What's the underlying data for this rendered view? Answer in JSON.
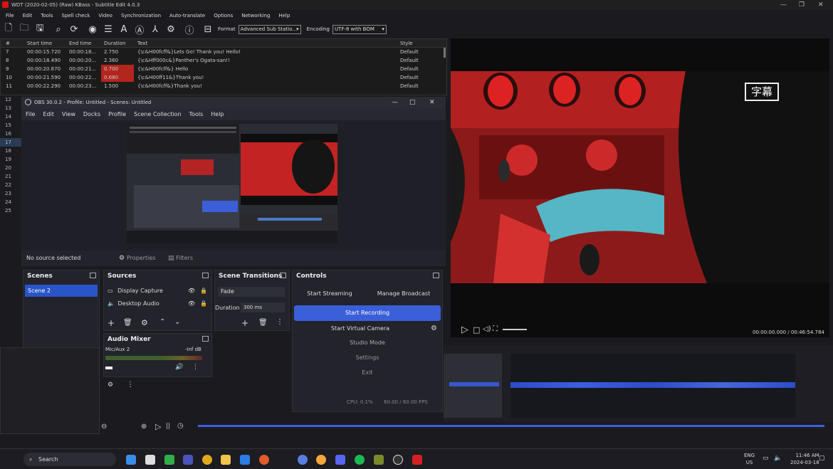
{
  "window": {
    "title": "WDT (2020-02-05) (Raw) KBass - Subtitle Edit 4.0.3"
  },
  "menu": [
    "File",
    "Edit",
    "Tools",
    "Spell check",
    "Video",
    "Synchronization",
    "Auto-translate",
    "Options",
    "Networking",
    "Help"
  ],
  "toolbar": {
    "icons": [
      "new-file-icon",
      "open-folder-icon",
      "save-icon",
      "find-icon",
      "replace-icon",
      "visual-sync-icon",
      "spell-check-icon",
      "fix-errors-icon",
      "translate-icon",
      "remove-text-icon",
      "settings-icon",
      "help-icon",
      "layout-icon"
    ],
    "format_label": "Format",
    "format_value": "Advanced Sub Statio...",
    "encoding_label": "Encoding",
    "encoding_value": "UTF-8 with BOM"
  },
  "grid": {
    "headers": [
      "#",
      "Start time",
      "End time",
      "Duration",
      "Text",
      "Style"
    ],
    "rows": [
      [
        "7",
        "00:00:15.720",
        "00:00:18...",
        "2.750",
        "{\\c&H00fcff&}Lets Go! Thank you! Hello!",
        "Default"
      ],
      [
        "8",
        "00:00:18.490",
        "00:00:20...",
        "2.360",
        "{\\c&Hff000c&}Panther's Ogata-san!!",
        "Default"
      ],
      [
        "9",
        "00:00:20.870",
        "00:00:21...",
        "0.700",
        "{\\c&H00fcff&} Hello",
        "Default"
      ],
      [
        "10",
        "00:00:21.590",
        "00:00:22...",
        "0.680",
        "{\\c&H00ff11&}Thank you!",
        "Default"
      ],
      [
        "11",
        "00:00:22.290",
        "00:00:23...",
        "1.500",
        "{\\c&H00fcff&}Thank you!",
        "Default"
      ]
    ],
    "row_numbers": [
      "12",
      "13",
      "14",
      "15",
      "16",
      "17",
      "18",
      "19",
      "20",
      "21",
      "22",
      "23",
      "24",
      "25"
    ]
  },
  "obs": {
    "title": "OBS 30.0.2 - Profile: Untitled - Scenes: Untitled",
    "menu": [
      "File",
      "Edit",
      "View",
      "Docks",
      "Profile",
      "Scene Collection",
      "Tools",
      "Help"
    ],
    "no_source": "No source selected",
    "properties": "Properties",
    "filters": "Filters",
    "scenes_title": "Scenes",
    "scene_item": "Scene 2",
    "sources_title": "Sources",
    "sources": [
      {
        "name": "Display Capture",
        "icon": "monitor-icon"
      },
      {
        "name": "Desktop Audio",
        "icon": "speaker-icon"
      }
    ],
    "transitions_title": "Scene Transitions",
    "transition_value": "Fade",
    "duration_label": "Duration",
    "duration_value": "300 ms",
    "controls_title": "Controls",
    "start_streaming": "Start Streaming",
    "manage_broadcast": "Manage Broadcast",
    "start_recording": "Start Recording",
    "start_virtual_camera": "Start Virtual Camera",
    "studio_mode": "Studio Mode",
    "settings": "Settings",
    "exit": "Exit",
    "audio_mixer_title": "Audio Mixer",
    "mixer_channel": "Mic/Aux 2",
    "mixer_level": "-inf dB",
    "cpu": "CPU: 0.1%",
    "fps": "60.00 / 60.00 FPS"
  },
  "video": {
    "badge": "字幕",
    "time": "00:00:00.000 / 00:46:54.784"
  },
  "taskbar": {
    "search": "Search",
    "lang_top": "ENG",
    "lang_bottom": "US",
    "time": "11:46 AM",
    "date": "2024-03-18"
  },
  "colors": {
    "record_blue": "#3b5fd9",
    "highlight_red": "#b3261e",
    "obs_bg": "#22232b"
  }
}
